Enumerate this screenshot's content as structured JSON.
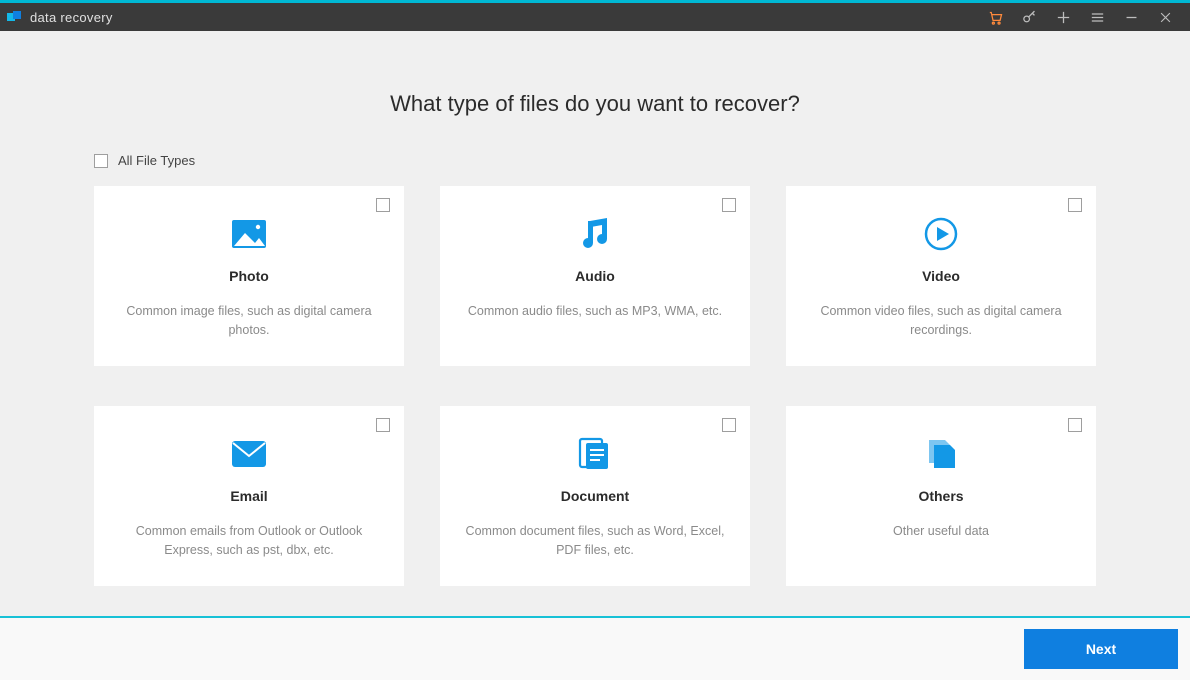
{
  "app": {
    "title": "data recovery",
    "accent_color": "#00b8d4",
    "primary_color": "#0f7fe0",
    "icon_color": "#1398e6"
  },
  "titlebar_icons": [
    {
      "name": "cart-icon"
    },
    {
      "name": "key-icon"
    },
    {
      "name": "plus-icon"
    },
    {
      "name": "menu-icon"
    },
    {
      "name": "minimize-icon"
    },
    {
      "name": "close-icon"
    }
  ],
  "heading": "What type of files do you want to recover?",
  "all_types": {
    "label": "All File Types",
    "checked": false
  },
  "cards": [
    {
      "id": "photo",
      "title": "Photo",
      "desc": "Common image files, such as digital camera photos.",
      "checked": false,
      "icon": "image-icon"
    },
    {
      "id": "audio",
      "title": "Audio",
      "desc": "Common audio files, such as MP3, WMA, etc.",
      "checked": false,
      "icon": "music-icon"
    },
    {
      "id": "video",
      "title": "Video",
      "desc": "Common video files, such as digital camera recordings.",
      "checked": false,
      "icon": "play-circle-icon"
    },
    {
      "id": "email",
      "title": "Email",
      "desc": "Common emails from Outlook or Outlook Express, such as pst, dbx, etc.",
      "checked": false,
      "icon": "mail-icon"
    },
    {
      "id": "document",
      "title": "Document",
      "desc": "Common document files, such as Word, Excel, PDF files, etc.",
      "checked": false,
      "icon": "document-icon"
    },
    {
      "id": "others",
      "title": "Others",
      "desc": "Other useful data",
      "checked": false,
      "icon": "files-icon"
    }
  ],
  "footer": {
    "next_label": "Next"
  }
}
